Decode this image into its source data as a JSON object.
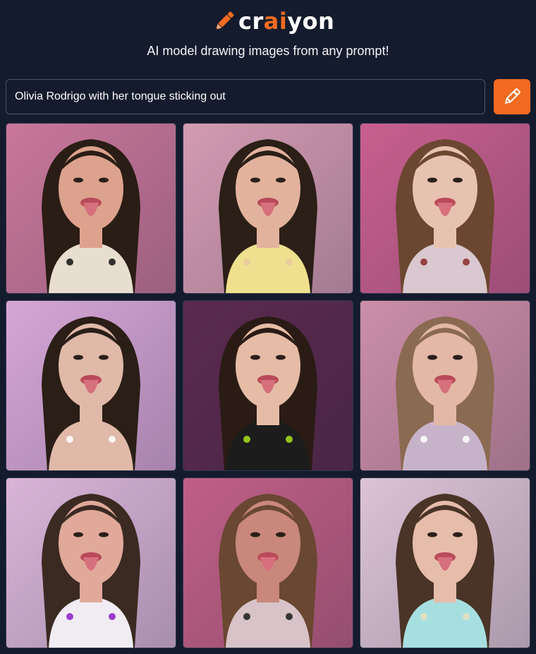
{
  "app": {
    "name_prefix": "cr",
    "name_accent": "ai",
    "name_suffix": "yon",
    "tagline": "AI model drawing images from any prompt!",
    "logo_icon": "pencil-icon"
  },
  "prompt": {
    "value": "Olivia Rodrigo with her tongue sticking out",
    "submit_icon": "pencil-icon"
  },
  "colors": {
    "background": "#141b2d",
    "accent": "#f26b21"
  },
  "images": [
    {
      "bg": "#c9779a",
      "hair": "#2a1d15",
      "skin": "#dca28d",
      "top": "#e8ded0",
      "extra": "#111111"
    },
    {
      "bg": "#d39bb2",
      "hair": "#2b1f17",
      "skin": "#e2b29d",
      "top": "#efe08f",
      "extra": "#e7c9a0"
    },
    {
      "bg": "#c85f8f",
      "hair": "#6b4630",
      "skin": "#e8c2b0",
      "top": "#d9c8cf",
      "extra": "#8a2a2a"
    },
    {
      "bg": "#d6a6d6",
      "hair": "#2a1e17",
      "skin": "#e0b9a8",
      "top": "#e0b9a8",
      "extra": "#ffffff"
    },
    {
      "bg": "#5b2a4f",
      "hair": "#2a1b14",
      "skin": "#e6bca6",
      "top": "#1c1c1c",
      "extra": "#a8e21f"
    },
    {
      "bg": "#cc8ea8",
      "hair": "#8b6a52",
      "skin": "#e3b8a6",
      "top": "#c7b3c9",
      "extra": "#ffffff"
    },
    {
      "bg": "#d9b5d8",
      "hair": "#3a2a22",
      "skin": "#e0a99a",
      "top": "#f1ecf2",
      "extra": "#8c1fc4"
    },
    {
      "bg": "#c05f86",
      "hair": "#6a4733",
      "skin": "#c9887b",
      "top": "#d8c4c8",
      "extra": "#1a1a1a"
    },
    {
      "bg": "#dcc3d6",
      "hair": "#4a3427",
      "skin": "#e6bcaa",
      "top": "#a7dfe0",
      "extra": "#e8e0c0"
    }
  ]
}
